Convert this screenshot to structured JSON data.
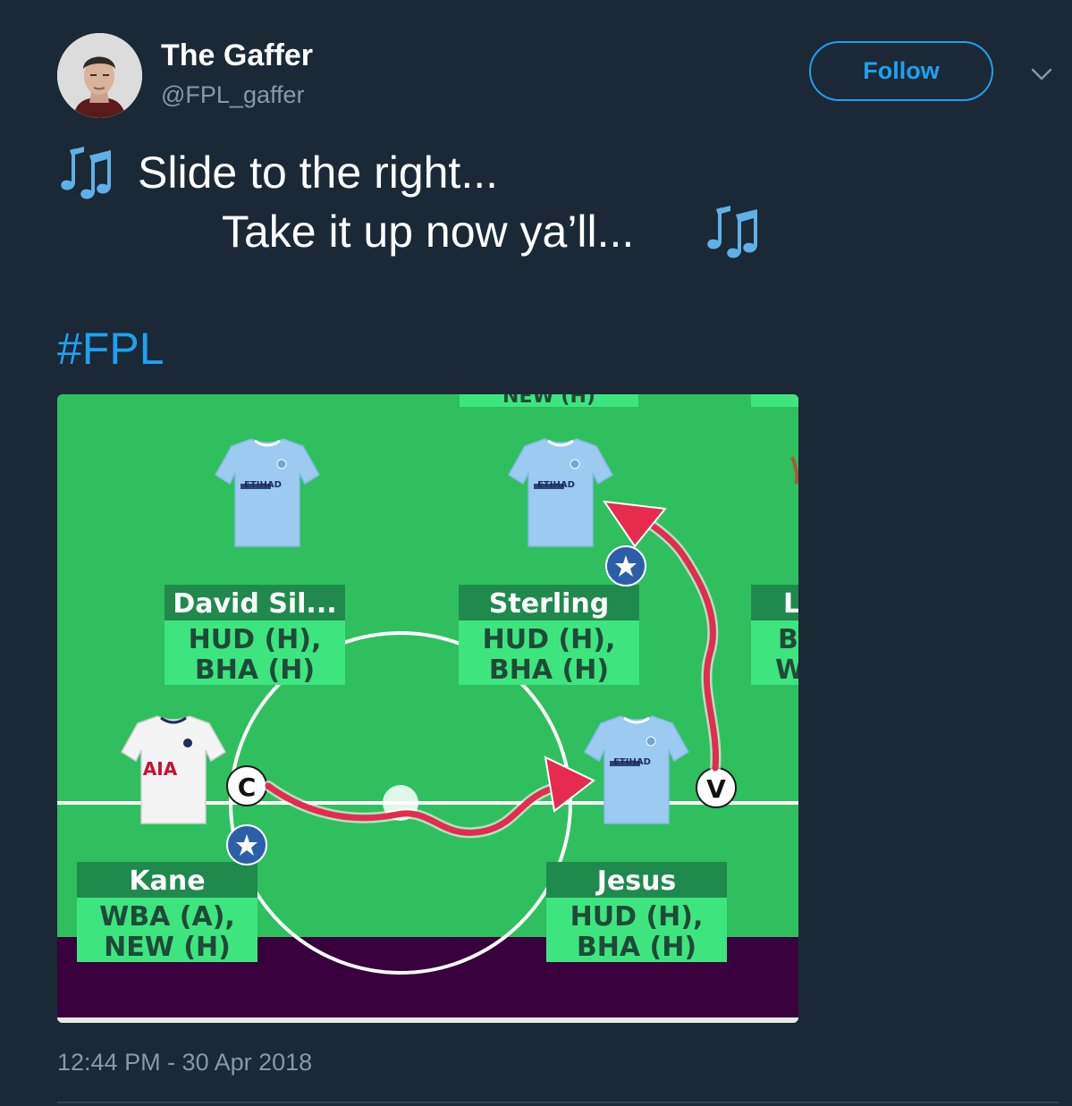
{
  "user": {
    "display_name": "The Gaffer",
    "handle": "@FPL_gaffer"
  },
  "follow_button": {
    "label": "Follow"
  },
  "tweet": {
    "line1": "Slide to the right...",
    "line2": "Take it up now ya’ll...",
    "hashtag": "#FPL",
    "timestamp": "12:44 PM - 30 Apr 2018"
  },
  "icons": {
    "avatar": "avatar-photo",
    "caret": "chevron-down-icon",
    "notes": "multiple-musical-notes-emoji",
    "arrow": "hand-drawn-red-arrow",
    "captain_badge": "captain-c-badge",
    "vice_badge": "vice-captain-v-badge",
    "star_badge": "star-badge-icon"
  },
  "colors": {
    "background": "#1b2836",
    "accent": "#1da1f2",
    "muted_text": "#8899a6",
    "pitch_green": "#2fbf5f",
    "label_dark_green": "#1f8a4c",
    "label_light_green": "#3ee57f",
    "city_shirt": "#9ccaf1",
    "arrow_red": "#e62b4f",
    "pitch_purple": "#38003c"
  },
  "pitch": {
    "top_partial_fixture": "NEW (H)",
    "right_partial_name": "L",
    "right_partial_fixture_1": "B",
    "right_partial_fixture_2": "W",
    "captain_badge": "C",
    "vice_badge": "V",
    "shirt_sponsor_city": "ETIHAD",
    "shirt_sponsor_spurs": "AIA",
    "players": [
      {
        "name": "David Sil...",
        "fixture1": "HUD (H),",
        "fixture2": "BHA (H)"
      },
      {
        "name": "Sterling",
        "fixture1": "HUD (H),",
        "fixture2": "BHA (H)"
      },
      {
        "name": "Kane",
        "fixture1": "WBA (A),",
        "fixture2": "NEW (H)"
      },
      {
        "name": "Jesus",
        "fixture1": "HUD (H),",
        "fixture2": "BHA (H)"
      }
    ]
  }
}
